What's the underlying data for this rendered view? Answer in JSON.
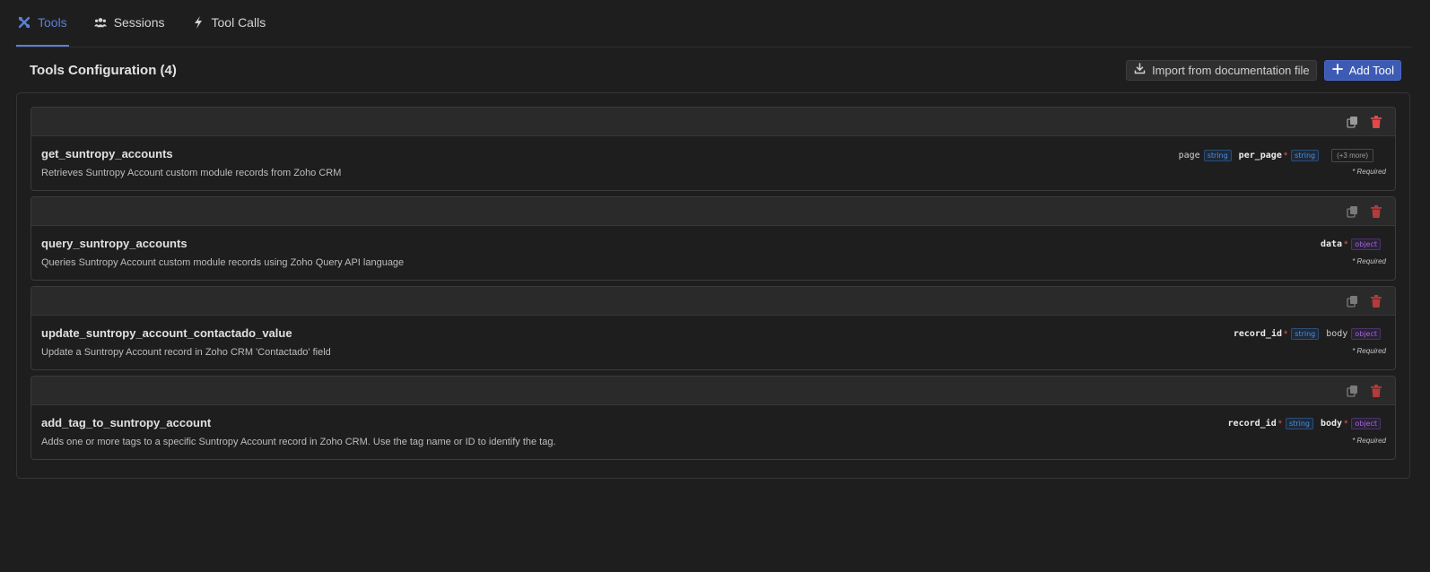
{
  "tabs": [
    {
      "label": "Tools",
      "icon": "tools-icon",
      "active": true
    },
    {
      "label": "Sessions",
      "icon": "users-icon",
      "active": false
    },
    {
      "label": "Tool Calls",
      "icon": "bolt-icon",
      "active": false
    }
  ],
  "header": {
    "title": "Tools Configuration (4)",
    "import_label": "Import from documentation file",
    "add_label": "Add Tool"
  },
  "colors": {
    "accent": "#3d5bb5",
    "tab_active": "#5b7fd6",
    "delete": "#e04a4a",
    "required_star": "#e05454"
  },
  "tools": [
    {
      "name": "get_suntropy_accounts",
      "description": "Retrieves Suntropy Account custom module records from Zoho CRM",
      "params": [
        {
          "name": "page",
          "type": "string",
          "required": false
        },
        {
          "name": "per_page",
          "type": "string",
          "required": true
        }
      ],
      "more": "(+3 more)",
      "required_note": "* Required"
    },
    {
      "name": "query_suntropy_accounts",
      "description": "Queries Suntropy Account custom module records using Zoho Query API language",
      "params": [
        {
          "name": "data",
          "type": "object",
          "required": true
        }
      ],
      "required_note": "* Required"
    },
    {
      "name": "update_suntropy_account_contactado_value",
      "description": "Update a Suntropy Account record in Zoho CRM 'Contactado' field",
      "params": [
        {
          "name": "record_id",
          "type": "string",
          "required": true
        },
        {
          "name": "body",
          "type": "object",
          "required": false
        }
      ],
      "required_note": "* Required"
    },
    {
      "name": "add_tag_to_suntropy_account",
      "description": "Adds one or more tags to a specific Suntropy Account record in Zoho CRM. Use the tag name or ID to identify the tag.",
      "params": [
        {
          "name": "record_id",
          "type": "string",
          "required": true
        },
        {
          "name": "body",
          "type": "object",
          "required": true
        }
      ],
      "required_note": "* Required"
    }
  ]
}
